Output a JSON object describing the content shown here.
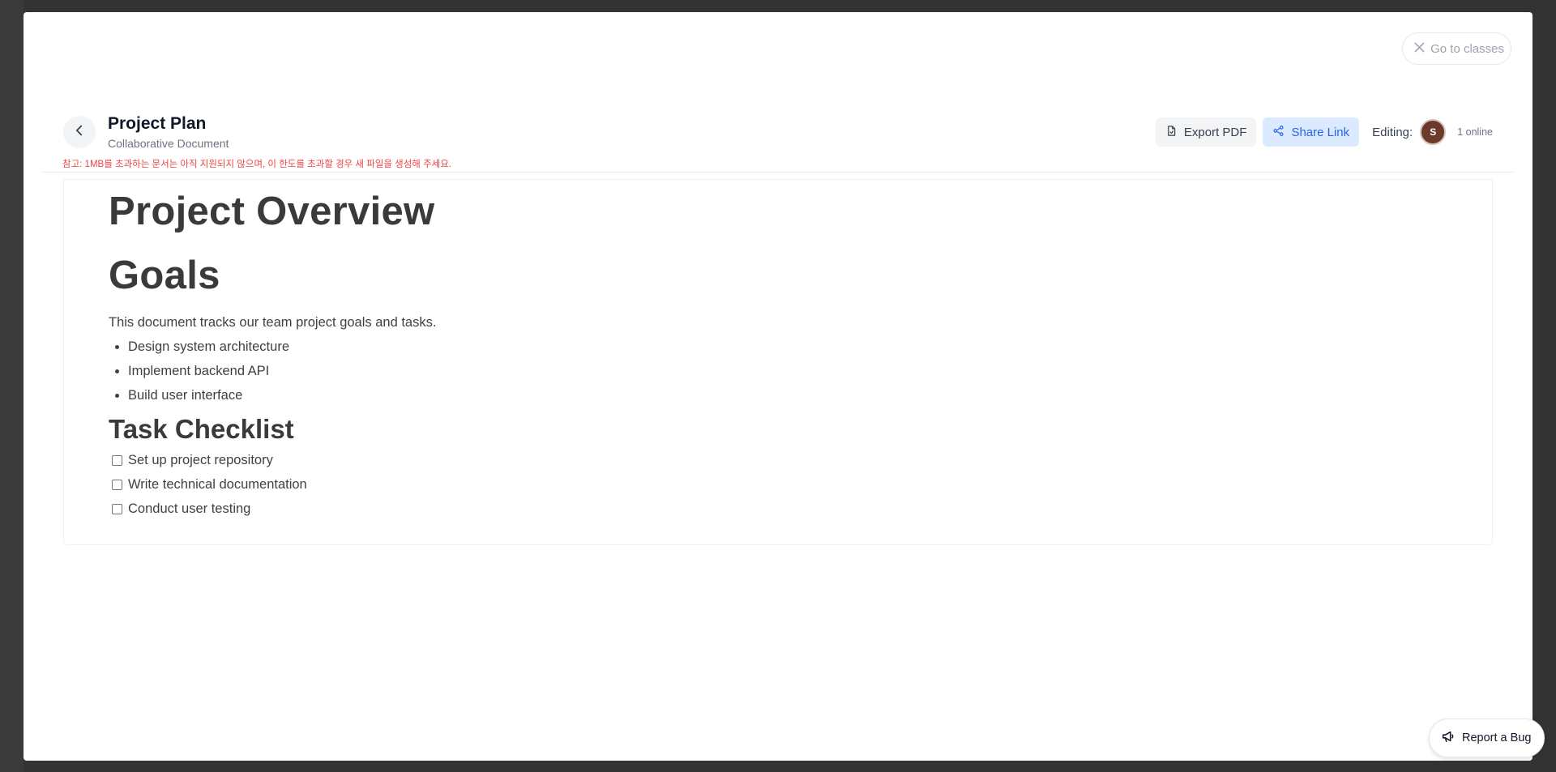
{
  "modal": {
    "close_label": "Go to classes"
  },
  "header": {
    "title": "Project Plan",
    "subtitle": "Collaborative Document",
    "size_note": "참고: 1MB를 초과하는 문서는 아직 지원되지 않으며, 이 한도를 초과할 경우 새 파일을 생성해 주세요.",
    "export_label": "Export PDF",
    "share_label": "Share Link",
    "editing_label": "Editing:",
    "avatar_initial": "S",
    "online_count": "1 online"
  },
  "document": {
    "heading_overview": "Project Overview",
    "heading_goals": "Goals",
    "intro": "This document tracks our team project goals and tasks.",
    "goals": [
      "Design system architecture",
      "Implement backend API",
      "Build user interface"
    ],
    "heading_tasks": "Task Checklist",
    "tasks": [
      {
        "label": "Set up project repository",
        "checked": false
      },
      {
        "label": "Write technical documentation",
        "checked": false
      },
      {
        "label": "Conduct user testing",
        "checked": false
      }
    ]
  },
  "bug_report": {
    "label": "Report a Bug"
  },
  "icons": {
    "close": "close-icon",
    "back": "chevron-left-icon",
    "export": "file-pdf-icon",
    "share": "share-icon",
    "bug": "megaphone-icon"
  },
  "colors": {
    "backdrop": "#333333",
    "note_red": "#ef4444",
    "share_bg": "#dbeafe",
    "share_text": "#2563eb",
    "avatar_bg": "#6b3a2a"
  }
}
